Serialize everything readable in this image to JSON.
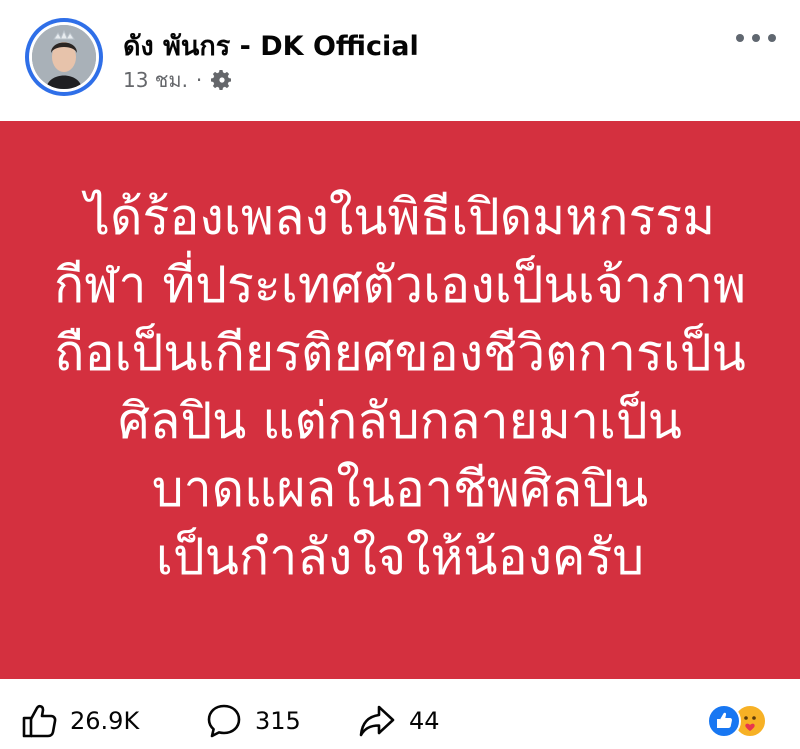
{
  "post": {
    "page_name": "ดัง พันกร - DK Official",
    "time": "13 ชม.",
    "separator": "·",
    "privacy_icon": "gear-icon",
    "more_icon": "more-dots-icon",
    "card_color": "#d4303f",
    "text_lines": [
      "ได้ร้องเพลงในพิธีเปิดมหกรรม",
      "กีฬา ที่ประเทศตัวเองเป็นเจ้าภาพ",
      "ถือเป็นเกียรติยศของชีวิตการเป็น",
      "ศิลปิน แต่กลับกลายมาเป็น",
      "บาดแผลในอาชีพศิลปิน",
      "เป็นกำลังใจให้น้องครับ"
    ]
  },
  "footer": {
    "likes": "26.9K",
    "comments": "315",
    "shares": "44",
    "like_icon": "thumbs-up-icon",
    "comment_icon": "comment-bubble-icon",
    "share_icon": "share-arrow-icon",
    "reaction_icons": [
      "like-reaction-icon",
      "care-reaction-icon"
    ],
    "accent": "#1877f2"
  }
}
